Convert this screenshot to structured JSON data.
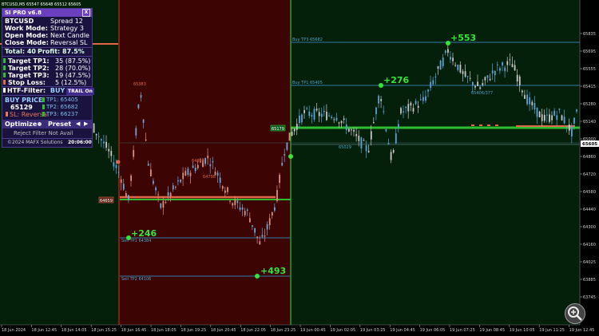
{
  "window": {
    "title": "BTCUSD,M5 65547 65648 65512 65605",
    "close_label": "X"
  },
  "panel": {
    "header": "SI PRO v6.8",
    "symbol": "BTCUSD",
    "spread_label": "Spread",
    "spread_value": "12",
    "work_mode_label": "Work Mode:",
    "work_mode_value": "Strategy 3",
    "open_mode_label": "Open Mode:",
    "open_mode_value": "Next Candle",
    "close_mode_label": "Close Mode:",
    "close_mode_value": "Reversal SL",
    "total_label": "Total: 40",
    "profit_label": "Profit: 87.5%",
    "targets": [
      {
        "label": "Target TP1:",
        "value": "35 (87.5%)",
        "color": "#29c229"
      },
      {
        "label": "Target TP2:",
        "value": "28 (70.0%)",
        "color": "#29c229"
      },
      {
        "label": "Target TP3:",
        "value": "19 (47.5%)",
        "color": "#29c229"
      },
      {
        "label": "Stop Loss:",
        "value": "5 (12.5%)",
        "color": "#e06a4a"
      }
    ],
    "htf_filter_label": "HTF-Filter:",
    "htf_filter_value": "BUY",
    "trail_label": "TRAIL On",
    "buy_price_label": "BUY PRICE",
    "buy_price_value": "65129",
    "sl_label": "SL: Reversal",
    "tp_values": [
      "TP1: 65405",
      "TP2: 65682",
      "TP3: 66237"
    ],
    "optimize_label": "Optimize",
    "preset_label": "Preset",
    "reject_label": "Reject Filter Not Avail",
    "copyright": "©2024 MAFX Solutions",
    "time": "20:06:00"
  },
  "price_axis": {
    "labels": [
      "65835",
      "65695",
      "65555",
      "65415",
      "65280",
      "65140",
      "65000",
      "64860",
      "64720",
      "64580",
      "64440",
      "64300",
      "64160",
      "64025",
      "63885",
      "63745"
    ],
    "current_price": "65605",
    "current_price_color": "#ffffff"
  },
  "time_axis": {
    "labels": [
      "18 Jun 2024",
      "18 Jun 12:45",
      "18 Jun 14:05",
      "18 Jun 15:25",
      "18 Jun 16:45",
      "18 Jun 18:05",
      "18 Jun 19:25",
      "18 Jun 20:45",
      "18 Jun 22:05",
      "18 Jun 23:25",
      "19 Jun 00:45",
      "19 Jun 02:05",
      "19 Jun 03:25",
      "19 Jun 04:45",
      "19 Jun 06:05",
      "19 Jun 07:25",
      "19 Jun 08:45",
      "19 Jun 10:05",
      "19 Jun 11:25",
      "19 Jun 12:45"
    ]
  },
  "annotations": {
    "buy_tp3": "Buy TP3 65682",
    "buy_tp1": "Buy TP1 65405",
    "buy_entry": "65129",
    "sell_entry": "64659",
    "sell_tp1": "Sell TP1 64384",
    "sell_tp2": "Sell TP2 64106",
    "low_label": "65029",
    "sell_label_high": "65383",
    "sell_mark_1": "64894",
    "sell_mark_2": "64798",
    "buy_mark": "65406/377",
    "profit_553": "+553",
    "profit_276": "+276",
    "profit_246": "+246",
    "profit_493": "+493",
    "price_tag_65179": "65179"
  },
  "colors": {
    "sell_zone": "#3d0404",
    "buy_zone": "#04200a",
    "bull_candle": "#c8c8c8",
    "bear_candle": "#5aa3d8",
    "bull_candle_sell": "#d89080",
    "bear_candle_sell": "#6fa5d6",
    "green_line": "#2ebd2e",
    "orange_line": "#e06848",
    "tp_line": "#2f7aa6",
    "profit_green": "#36e636",
    "red_vline": "#d02020"
  }
}
